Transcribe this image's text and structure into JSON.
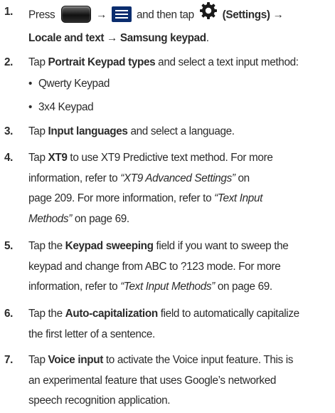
{
  "steps": [
    {
      "num": "1.",
      "line1_press": "Press",
      "line1_arrow1": "→",
      "line1_mid": "and then tap",
      "line1_settings": "(Settings)",
      "line1_arrow2": "→",
      "line2_locale": "Locale and text",
      "line2_arrow": "→",
      "line2_keypad": "Samsung keypad",
      "line2_end": "."
    },
    {
      "num": "2.",
      "pre": "Tap ",
      "bold": "Portrait Keypad types",
      "post": " and select a text input method:",
      "bullets": [
        "Qwerty Keypad",
        "3x4 Keypad"
      ]
    },
    {
      "num": "3.",
      "pre": "Tap ",
      "bold": "Input languages",
      "post": " and select a language."
    },
    {
      "num": "4.",
      "pre": "Tap ",
      "bold": "XT9",
      "post": " to use XT9 Predictive text method. For more",
      "line2": "information, refer to ",
      "line2_ital": "“XT9 Advanced Settings”",
      "line2_post": "  on",
      "line3": "page 209. For more information, refer to ",
      "line3_ital": "“Text Input",
      "line4_ital": "Methods”",
      "line4_post": "  on page 69."
    },
    {
      "num": "5.",
      "pre": "Tap the ",
      "bold": "Keypad sweeping",
      "post": " field if you want to sweep the",
      "line2": "keypad and change from ABC to ?123 mode. For more",
      "line3": "information, refer to ",
      "line3_ital": "“Text Input Methods”",
      "line3_post": "  on page 69."
    },
    {
      "num": "6.",
      "pre": "Tap the ",
      "bold": "Auto-capitalization",
      "post": " field to automatically capitalize",
      "line2": "the first letter of a sentence."
    },
    {
      "num": "7.",
      "pre": "Tap ",
      "bold": "Voice input",
      "post": " to activate the Voice input feature. This is",
      "line2": "an experimental feature that uses Google’s networked",
      "line3": "speech recognition application."
    }
  ],
  "icons": [
    "home-key-icon",
    "menu-key-icon",
    "settings-gear-icon"
  ]
}
